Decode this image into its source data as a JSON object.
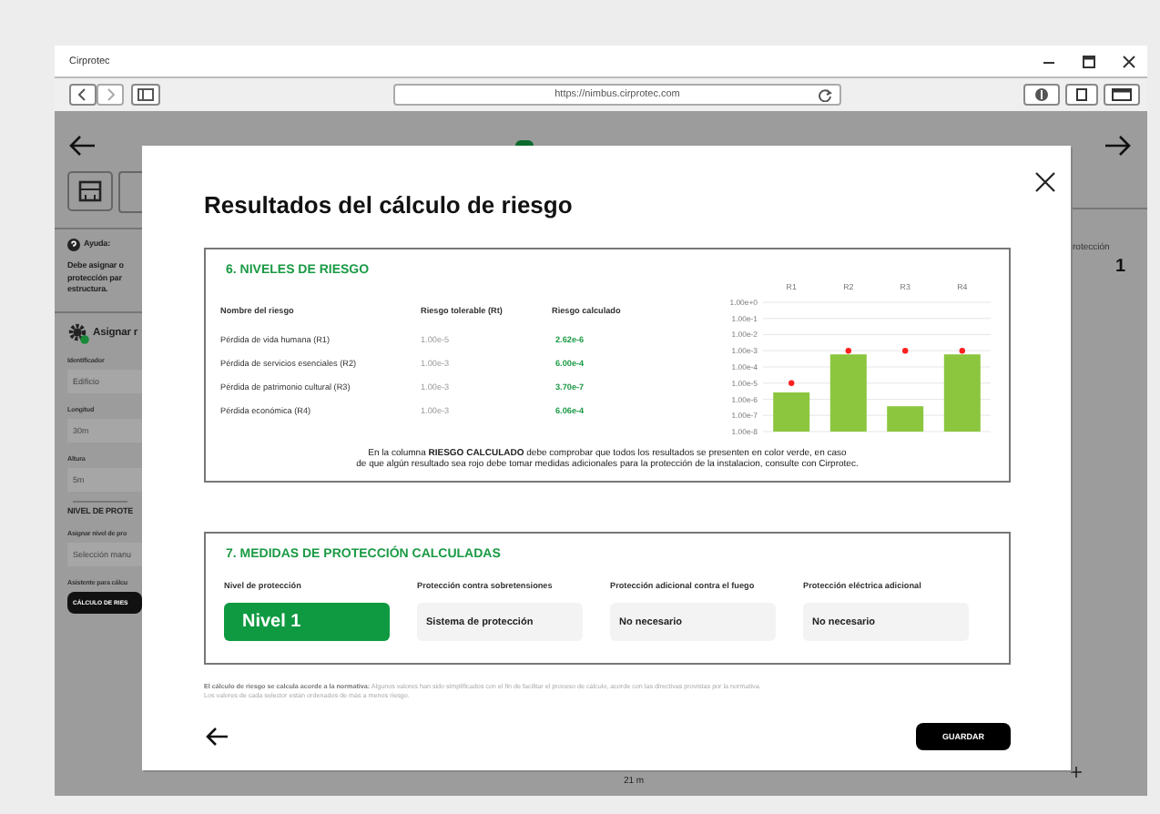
{
  "browser": {
    "title": "Cirprotec",
    "url": "https://nimbus.cirprotec.com"
  },
  "background": {
    "help_title": "Ayuda:",
    "help_lines": [
      "Debe asignar o",
      "protección par",
      "estructura."
    ],
    "section_title": "Asignar r",
    "fields": [
      {
        "label": "Identificador",
        "value": "Edificio"
      },
      {
        "label": "Longitud",
        "placeholder": "30m"
      },
      {
        "label": "Altura",
        "placeholder": "5m"
      }
    ],
    "protection_heading": "NIVEL DE PROTE",
    "protection_label": "Asignar nivel de pro",
    "protection_value": "Selección manu",
    "assistant_label": "Asistente para cálcu",
    "assistant_button": "CÁLCULO DE RIES",
    "right_label": "rotección",
    "right_value": "1",
    "dimension": "21 m"
  },
  "modal": {
    "title": "Resultados del cálculo de riesgo",
    "risk_section": {
      "title": "6. NIVELES DE RIESGO",
      "columns": [
        "Nombre del riesgo",
        "Riesgo tolerable (Rt)",
        "Riesgo calculado"
      ],
      "rows": [
        {
          "name": "Pérdida de vida humana (R1)",
          "tolerable": "1.00e-5",
          "calculated": "2.62e-6",
          "ok": true
        },
        {
          "name": "Pérdida de servicios esenciales (R2)",
          "tolerable": "1.00e-3",
          "calculated": "6.00e-4",
          "ok": true
        },
        {
          "name": "Pérdida de patrimonio cultural (R3)",
          "tolerable": "1.00e-3",
          "calculated": "3.70e-7",
          "ok": true
        },
        {
          "name": "Pérdida económica (R4)",
          "tolerable": "1.00e-3",
          "calculated": "6.06e-4",
          "ok": true
        }
      ],
      "chart": {
        "categories": [
          "R1",
          "R2",
          "R3",
          "R4"
        ],
        "axis_labels": [
          "1.00e+0",
          "1.00e-1",
          "1.00e-2",
          "1.00e-3",
          "1.00e-4",
          "1.00e-5",
          "1.00e-6",
          "1.00e-7",
          "1.00e-8"
        ]
      },
      "note": [
        "En la columna **RIESGO CALCULADO** debe comprobar que todos los resultados se presenten en color verde, en caso",
        "de que algún resultado sea rojo debe tomar medidas adicionales para la protección de la instalacion, consulte con Cirprotec."
      ]
    },
    "measures_section": {
      "title": "7. MEDIDAS DE PROTECCIÓN CALCULADAS",
      "items": [
        {
          "label": "Nivel de protección",
          "value": "Nivel 1",
          "highlighted": true
        },
        {
          "label": "Protección contra sobretensiones",
          "value": "Sistema de protección",
          "highlighted": false
        },
        {
          "label": "Protección adicional contra el fuego",
          "value": "No necesario",
          "highlighted": false
        },
        {
          "label": "Protección eléctrica adicional",
          "value": "No necesario",
          "highlighted": false
        }
      ]
    },
    "footnote": [
      "**El cálculo de riesgo se calcula acorde a la normativa:** Algunos valores han sido simplificados con el fin de facilitar el proceso de cálculo, acorde con las directivas provistas por la normativa.",
      "Los valores de cada selector están ordenados de más a menos riesgo."
    ],
    "save_button": "GUARDAR"
  }
}
